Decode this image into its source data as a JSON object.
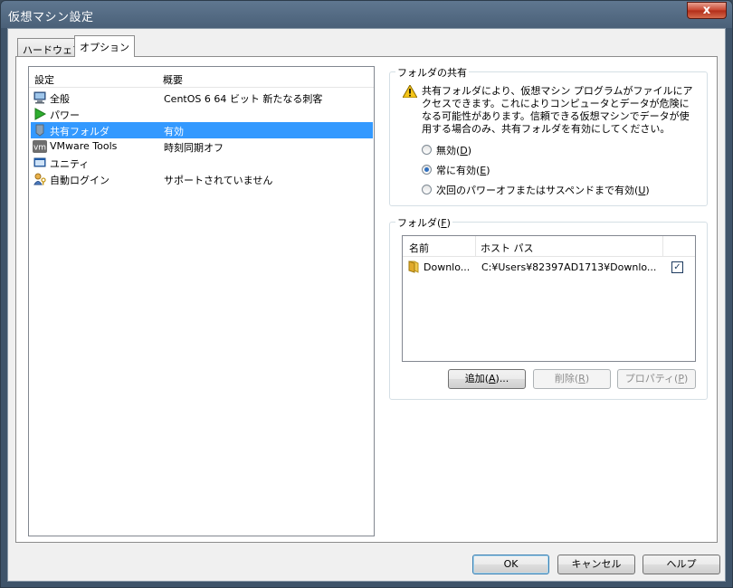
{
  "window": {
    "title": "仮想マシン設定",
    "close_label": "x"
  },
  "tabs": [
    {
      "label": "ハードウェア"
    },
    {
      "label": "オプション"
    }
  ],
  "settings_list": {
    "col_setting": "設定",
    "col_summary": "概要",
    "items": [
      {
        "name": "全般",
        "summary": "CentOS 6 64 ビット 新たなる刺客",
        "icon": "computer-icon"
      },
      {
        "name": "パワー",
        "summary": "",
        "icon": "play-icon"
      },
      {
        "name": "共有フォルダ",
        "summary": "有効",
        "icon": "shared-folder-icon",
        "selected": true
      },
      {
        "name": "VMware Tools",
        "summary": "時刻同期オフ",
        "icon": "vm-icon"
      },
      {
        "name": "ユニティ",
        "summary": "",
        "icon": "unity-icon"
      },
      {
        "name": "自動ログイン",
        "summary": "サポートされていません",
        "icon": "auto-login-icon"
      }
    ]
  },
  "folder_sharing": {
    "label": "フォルダの共有",
    "warning": "共有フォルダにより、仮想マシン プログラムがファイルにアクセスできます。これによりコンピュータとデータが危険になる可能性があります。信頼できる仮想マシンでデータが使用する場合のみ、共有フォルダを有効にしてください。",
    "options": [
      {
        "label": "無効",
        "key": "D",
        "checked": false
      },
      {
        "label": "常に有効",
        "key": "E",
        "checked": true
      },
      {
        "label": "次回のパワーオフまたはサスペンドまで有効",
        "key": "U",
        "checked": false
      }
    ]
  },
  "folders": {
    "label": "フォルダ",
    "key": "F",
    "col_name": "名前",
    "col_host_path": "ホスト パス",
    "rows": [
      {
        "name": "Downlo...",
        "host_path": "C:¥Users¥82397AD1713¥Downlo...",
        "enabled": true
      }
    ],
    "add_label": "追加",
    "add_key": "A",
    "add_suffix": "...",
    "remove_label": "削除",
    "remove_key": "R",
    "props_label": "プロパティ",
    "props_key": "P"
  },
  "footer": {
    "ok_label": "OK",
    "cancel_label": "キャンセル",
    "help_label": "ヘルプ"
  },
  "colors": {
    "selection": "#3399ff",
    "title_bar": "#4a6078",
    "close": "#c7442e"
  }
}
